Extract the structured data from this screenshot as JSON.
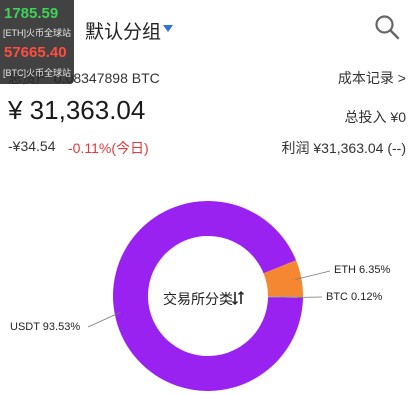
{
  "ticker_overlay": {
    "eth_price": "1785.59",
    "eth_label": "[ETH]火币全球站",
    "btc_price": "57665.40",
    "btc_label": "[BTC]火币全球站"
  },
  "header": {
    "group_title": "默认分组",
    "search_icon": "search-icon"
  },
  "summary": {
    "total_label": "总资产 0.08347898 BTC",
    "cost_link": "成本记录 >",
    "total_value": "¥ 31,363.04",
    "invest_label": "总投入 ¥0",
    "change_abs": "-¥34.54",
    "change_pct": "-0.11%(今日)",
    "profit_label": "利润 ¥31,363.04 (--)"
  },
  "colors": {
    "usdt": "#9a22f0",
    "eth": "#f58732",
    "btc": "#4a90e2",
    "negative": "#e0393e",
    "positive": "#3fd25a"
  },
  "chart_data": {
    "type": "pie",
    "center_label": "交易所分类",
    "slices": [
      {
        "name": "USDT",
        "value": 93.53,
        "label": "USDT 93.53%"
      },
      {
        "name": "ETH",
        "value": 6.35,
        "label": "ETH 6.35%"
      },
      {
        "name": "BTC",
        "value": 0.12,
        "label": "BTC 0.12%"
      }
    ]
  }
}
